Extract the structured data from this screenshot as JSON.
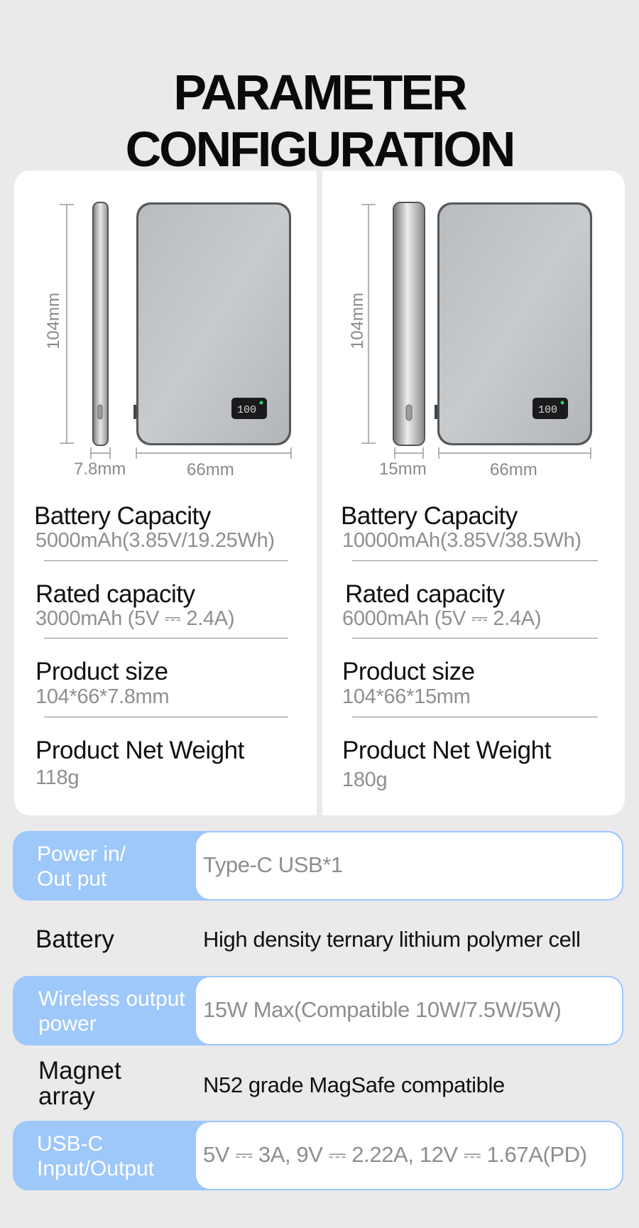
{
  "title": "PARAMETER CONFIGURATION",
  "products": [
    {
      "dims": {
        "height": "104mm",
        "thickness": "7.8mm",
        "width": "66mm"
      },
      "screen_text": "100",
      "specs": [
        {
          "heading": "Battery Capacity",
          "value": "5000mAh(3.85V/19.25Wh)"
        },
        {
          "heading": "Rated capacity",
          "value": "3000mAh (5V ⎓ 2.4A)"
        },
        {
          "heading": "Product size",
          "value": "104*66*7.8mm"
        },
        {
          "heading": "Product Net Weight",
          "value": "118g"
        }
      ]
    },
    {
      "dims": {
        "height": "104mm",
        "thickness": "15mm",
        "width": "66mm"
      },
      "screen_text": "100",
      "specs": [
        {
          "heading": "Battery Capacity",
          "value": "10000mAh(3.85V/38.5Wh)"
        },
        {
          "heading": "Rated capacity",
          "value": "6000mAh (5V ⎓ 2.4A)"
        },
        {
          "heading": "Product size",
          "value": "104*66*15mm"
        },
        {
          "heading": "Product Net Weight",
          "value": "180g"
        }
      ]
    }
  ],
  "rows": [
    {
      "label_line1": "Power in/",
      "label_line2": "Out put",
      "value": "Type-C USB*1"
    },
    {
      "label_line1": "Battery",
      "label_line2": "",
      "value": "High density ternary lithium polymer cell"
    },
    {
      "label_line1": "Wireless output",
      "label_line2": "power",
      "value": "15W Max(Compatible 10W/7.5W/5W)"
    },
    {
      "label_line1": "Magnet",
      "label_line2": "array",
      "value": "N52 grade MagSafe compatible"
    },
    {
      "label_line1": "USB-C",
      "label_line2": "Input/Output",
      "value": "5V ⎓ 3A, 9V ⎓ 2.22A, 12V ⎓ 1.67A(PD)"
    }
  ],
  "colors": {
    "accent_blue": "#9ec7fa",
    "page_bg": "#eaeaeb"
  }
}
